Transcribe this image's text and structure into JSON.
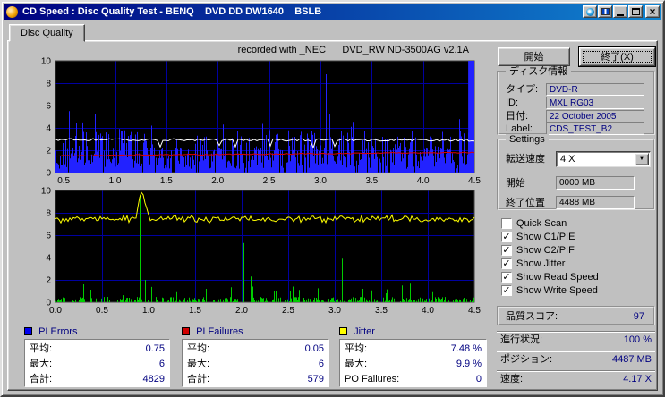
{
  "window": {
    "title": "CD Speed : Disc Quality Test - BENQ    DVD DD DW1640    BSLB"
  },
  "tab": {
    "label": "Disc Quality"
  },
  "header": {
    "recorded": "recorded with _NEC      DVD_RW ND-3500AG v2.1A"
  },
  "buttons": {
    "start": "開始",
    "exit": "終了(X)"
  },
  "icons": {
    "close": "×",
    "combo_arrow": "▼",
    "check": "✓"
  },
  "disc_info": {
    "group_label": "ディスク情報",
    "rows": [
      {
        "label": "タイプ:",
        "value": "DVD-R"
      },
      {
        "label": "ID:",
        "value": "MXL RG03"
      },
      {
        "label": "日付:",
        "value": "22 October 2005"
      },
      {
        "label": "Label:",
        "value": "CDS_TEST_B2"
      }
    ]
  },
  "settings": {
    "group_label": "Settings",
    "speed_label": "転送速度",
    "speed_value": "4 X",
    "start_label": "開始",
    "start_value": "0000 MB",
    "end_label": "終了位置",
    "end_value": "4488 MB"
  },
  "checkboxes": [
    {
      "label": "Quick Scan",
      "checked": false
    },
    {
      "label": "Show C1/PIE",
      "checked": true
    },
    {
      "label": "Show C2/PIF",
      "checked": true
    },
    {
      "label": "Show Jitter",
      "checked": true
    },
    {
      "label": "Show Read Speed",
      "checked": true
    },
    {
      "label": "Show Write Speed",
      "checked": true
    }
  ],
  "quality": {
    "label": "品質スコア:",
    "value": "97"
  },
  "status": [
    {
      "label": "進行状況:",
      "value": "100 %"
    },
    {
      "label": "ポジション:",
      "value": "4487 MB"
    },
    {
      "label": "速度:",
      "value": "4.17 X"
    }
  ],
  "stats_panels": [
    {
      "name": "PI Errors",
      "color": "#0000f0",
      "rows": [
        {
          "label": "平均:",
          "value": "0.75"
        },
        {
          "label": "最大:",
          "value": "6"
        },
        {
          "label": "合計:",
          "value": "4829"
        }
      ]
    },
    {
      "name": "PI Failures",
      "color": "#d00000",
      "rows": [
        {
          "label": "平均:",
          "value": "0.05"
        },
        {
          "label": "最大:",
          "value": "6"
        },
        {
          "label": "合計:",
          "value": "579"
        }
      ]
    },
    {
      "name": "Jitter",
      "color": "#ffff00",
      "rows": [
        {
          "label": "平均:",
          "value": "7.48 %"
        },
        {
          "label": "最大:",
          "value": "9.9 %"
        },
        {
          "label": "PO Failures:",
          "value": "0"
        }
      ]
    }
  ],
  "chart_data": [
    {
      "type": "bar",
      "name": "PI Errors scan",
      "x_range": [
        0.42,
        4.5
      ],
      "x_ticks": [
        "0.5",
        "1.0",
        "1.5",
        "2.0",
        "2.5",
        "3.0",
        "3.5",
        "4.0",
        "4.5"
      ],
      "x_tick_values": [
        0.5,
        1.0,
        1.5,
        2.0,
        2.5,
        3.0,
        3.5,
        4.0,
        4.5
      ],
      "y_ticks": [
        "10",
        "8",
        "6",
        "4",
        "2",
        "0"
      ],
      "ylim": [
        0,
        10
      ],
      "bg": "#000000",
      "grid_color": "#0000a0",
      "bar_color": "#2222ff",
      "avg": 0.75,
      "max": 6,
      "total": 4829,
      "spikes": [
        [
          0.5,
          3.2
        ],
        [
          0.55,
          5.5
        ],
        [
          0.62,
          4.4
        ],
        [
          0.72,
          3.6
        ],
        [
          0.8,
          5.2
        ],
        [
          1.08,
          5.0
        ],
        [
          1.2,
          3.4
        ],
        [
          1.35,
          4.2
        ],
        [
          1.6,
          3.0
        ],
        [
          1.8,
          3.3
        ],
        [
          2.05,
          4.3
        ],
        [
          2.3,
          3.1
        ],
        [
          2.5,
          3.8
        ],
        [
          2.75,
          3.2
        ],
        [
          3.05,
          8.8
        ],
        [
          3.09,
          5.2
        ],
        [
          3.3,
          4.1
        ],
        [
          3.6,
          3.2
        ],
        [
          3.9,
          3.0
        ],
        [
          4.15,
          3.3
        ],
        [
          4.35,
          4.0
        ]
      ],
      "end_block": {
        "from": 4.44,
        "to": 4.5,
        "value": 10
      },
      "lines": [
        {
          "name": "write-speed",
          "color": "#e00000",
          "base": 1.5,
          "slope": 0.3,
          "noise": 0.05
        },
        {
          "name": "read-speed",
          "color": "#ffffff",
          "base": 2.95,
          "slope": -0.05,
          "noise": 0.1,
          "dip": 0.6
        }
      ]
    },
    {
      "type": "line+bar",
      "name": "Jitter and PI Failures scan",
      "x_range": [
        0,
        4.5
      ],
      "x_ticks": [
        "0.0",
        "0.5",
        "1.0",
        "1.5",
        "2.0",
        "2.5",
        "3.0",
        "3.5",
        "4.0",
        "4.5"
      ],
      "x_tick_values": [
        0,
        0.5,
        1.0,
        1.5,
        2.0,
        2.5,
        3.0,
        3.5,
        4.0,
        4.5
      ],
      "y_ticks": [
        "10",
        "8",
        "6",
        "4",
        "2",
        "0"
      ],
      "ylim": [
        0,
        10
      ],
      "bg": "#000000",
      "grid_color": "#0000a0",
      "bar_color": "#00cc00",
      "line_color": "#ffff00",
      "jitter_base": 7.45,
      "jitter_avg": 7.48,
      "jitter_max": 9.9,
      "pif_avg": 0.05,
      "pif_max": 6,
      "pif_total": 579,
      "po_failures": 0,
      "spikes": [
        [
          0.3,
          1.6
        ],
        [
          0.9,
          9.6
        ],
        [
          0.96,
          2.0
        ],
        [
          1.3,
          0.9
        ],
        [
          1.62,
          1.2
        ],
        [
          2.02,
          5.3
        ],
        [
          2.1,
          2.3
        ],
        [
          2.35,
          1.0
        ],
        [
          2.55,
          1.4
        ],
        [
          2.62,
          1.1
        ],
        [
          3.08,
          3.9
        ],
        [
          3.3,
          1.2
        ],
        [
          3.55,
          0.8
        ],
        [
          3.72,
          1.5
        ],
        [
          4.05,
          0.9
        ],
        [
          4.3,
          1.1
        ]
      ],
      "jitter_bump": [
        0.93,
        2.2
      ]
    }
  ]
}
